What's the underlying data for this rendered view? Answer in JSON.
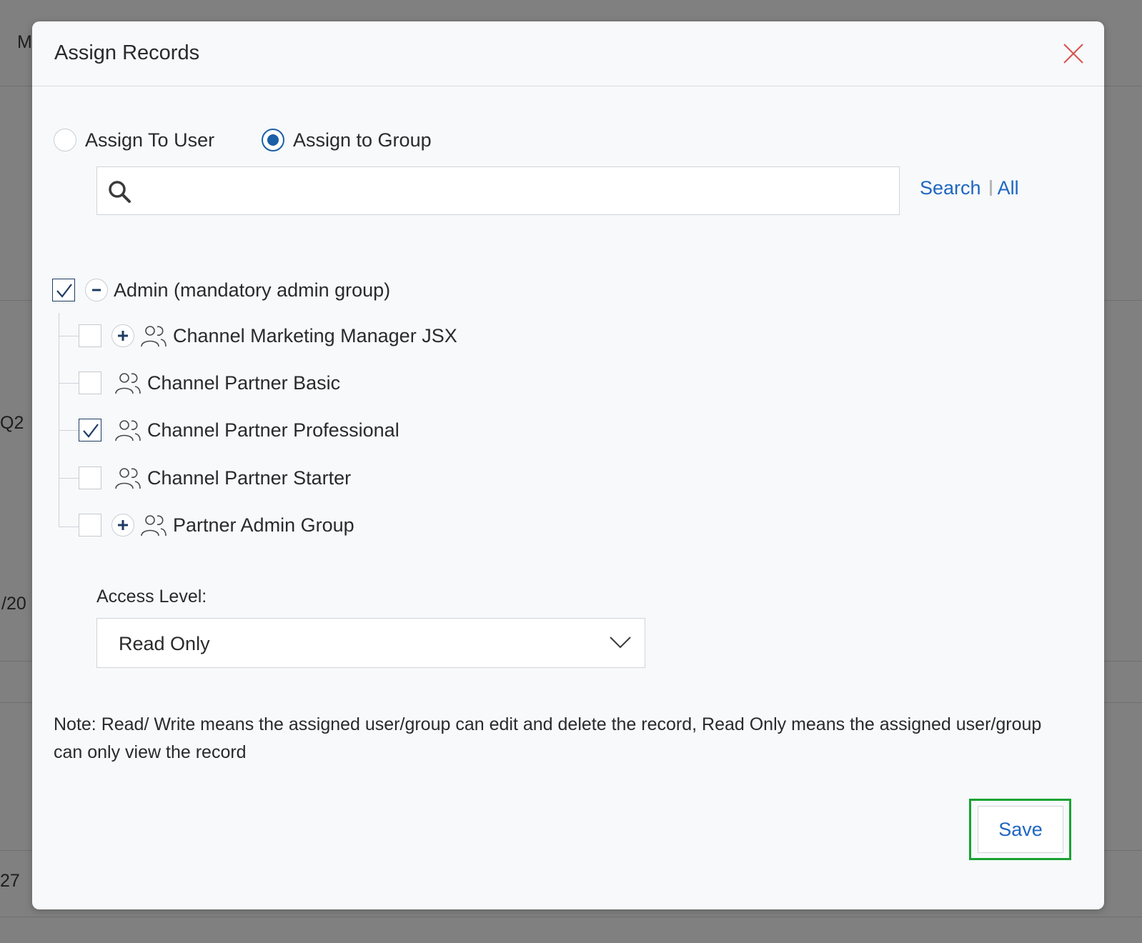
{
  "background": {
    "fragments": [
      "M",
      "Q2",
      "/20",
      "27"
    ]
  },
  "modal": {
    "title": "Assign Records",
    "close_icon": "close-icon"
  },
  "assign_options": [
    {
      "label": "Assign To User",
      "selected": false
    },
    {
      "label": "Assign to Group",
      "selected": true
    }
  ],
  "search": {
    "value": "",
    "placeholder": "",
    "search_label": "Search",
    "all_label": "All"
  },
  "tree": {
    "root": {
      "label": "Admin (mandatory admin group)",
      "checked": true,
      "expanded": true
    },
    "children": [
      {
        "label": "Channel Marketing Manager JSX",
        "checked": false,
        "expandable": true
      },
      {
        "label": "Channel Partner Basic",
        "checked": false,
        "expandable": false
      },
      {
        "label": "Channel Partner Professional",
        "checked": true,
        "expandable": false
      },
      {
        "label": "Channel Partner Starter",
        "checked": false,
        "expandable": false
      },
      {
        "label": "Partner Admin Group",
        "checked": false,
        "expandable": true
      }
    ]
  },
  "access": {
    "label": "Access Level:",
    "selected": "Read Only"
  },
  "note": "Note: Read/ Write means the assigned user/group can edit and delete the record, Read Only means the assigned user/group can only view the record",
  "actions": {
    "save_label": "Save"
  },
  "colors": {
    "accent": "#1b5fa6",
    "link": "#1f66c1",
    "close": "#d9534f",
    "focus": "#19a233"
  }
}
